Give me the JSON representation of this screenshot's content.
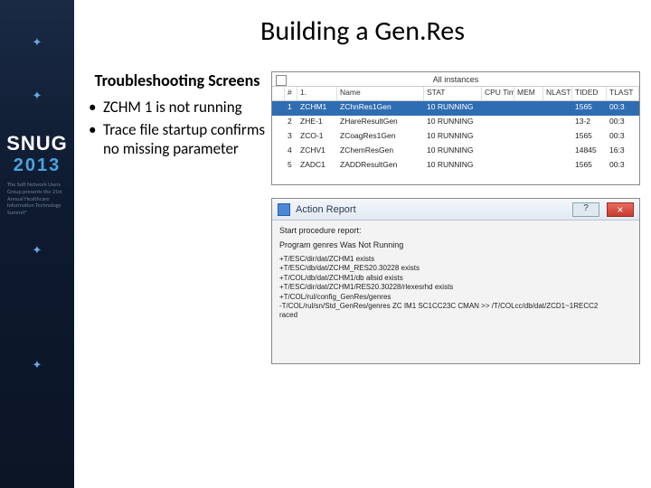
{
  "sidebar": {
    "logo_top": "SNUG",
    "logo_year": "2013",
    "tagline": "The Soft Network Users Group presents the 21st Annual Healthcare Information Technology Summit®"
  },
  "title": "Building a Gen.Res",
  "text": {
    "subtitle": "Troubleshooting Screens",
    "bullets": [
      "ZCHM 1 is not running",
      "Trace file startup confirms no missing parameter"
    ]
  },
  "panel1": {
    "toplabel": "All instances",
    "headers": [
      "",
      "#",
      "1.",
      "Name",
      "STAT",
      "CPU Time",
      "MEM",
      "NLAST",
      "TIDED",
      "TLAST"
    ],
    "rows": [
      {
        "sel": true,
        "cells": [
          "",
          "1",
          "ZCHM1",
          "ZChnRes1Gen",
          "10 RUNNING",
          "",
          "",
          "",
          "1565",
          "00:3"
        ]
      },
      {
        "sel": false,
        "cells": [
          "",
          "2",
          "ZHE-1",
          "ZHareResultGen",
          "10 RUNNING",
          "",
          "",
          "",
          "13-2",
          "00:3"
        ]
      },
      {
        "sel": false,
        "cells": [
          "",
          "3",
          "ZCO-1",
          "ZCoagRes1Gen",
          "10 RUNNING",
          "",
          "",
          "",
          "1565",
          "00:3"
        ]
      },
      {
        "sel": false,
        "cells": [
          "",
          "4",
          "ZCHV1",
          "ZChemResGen",
          "10 RUNNING",
          "",
          "",
          "",
          "14845",
          "16:3"
        ]
      },
      {
        "sel": false,
        "cells": [
          "",
          "5",
          "ZADC1",
          "ZADDResultGen",
          "10 RUNNING",
          "",
          "",
          "",
          "1565",
          "00:3"
        ]
      }
    ]
  },
  "panel2": {
    "window_title": "Action Report",
    "heading": "Start procedure report:",
    "status": "Program genres Was Not Running",
    "lines": [
      "+T/ESC/dir/dat/ZCHM1 exists",
      "+T/ESC/db/dat/ZCHM_RES20.30228 exists",
      "+T/COL/db/dat/ZCHM1/db allsid exists",
      "+T/ESC/dir/dat/ZCHM1/RES20.30228/rlexesrhd exists",
      "+T/COL/rul/config_GenRes/genres",
      "-T/COL/rul/sn/Std_GenRes/genres ZC IM1 SC1CC23C CMAN >> /T/COLcc/db/dat/ZCD1~1RECC2",
      "raced"
    ]
  }
}
